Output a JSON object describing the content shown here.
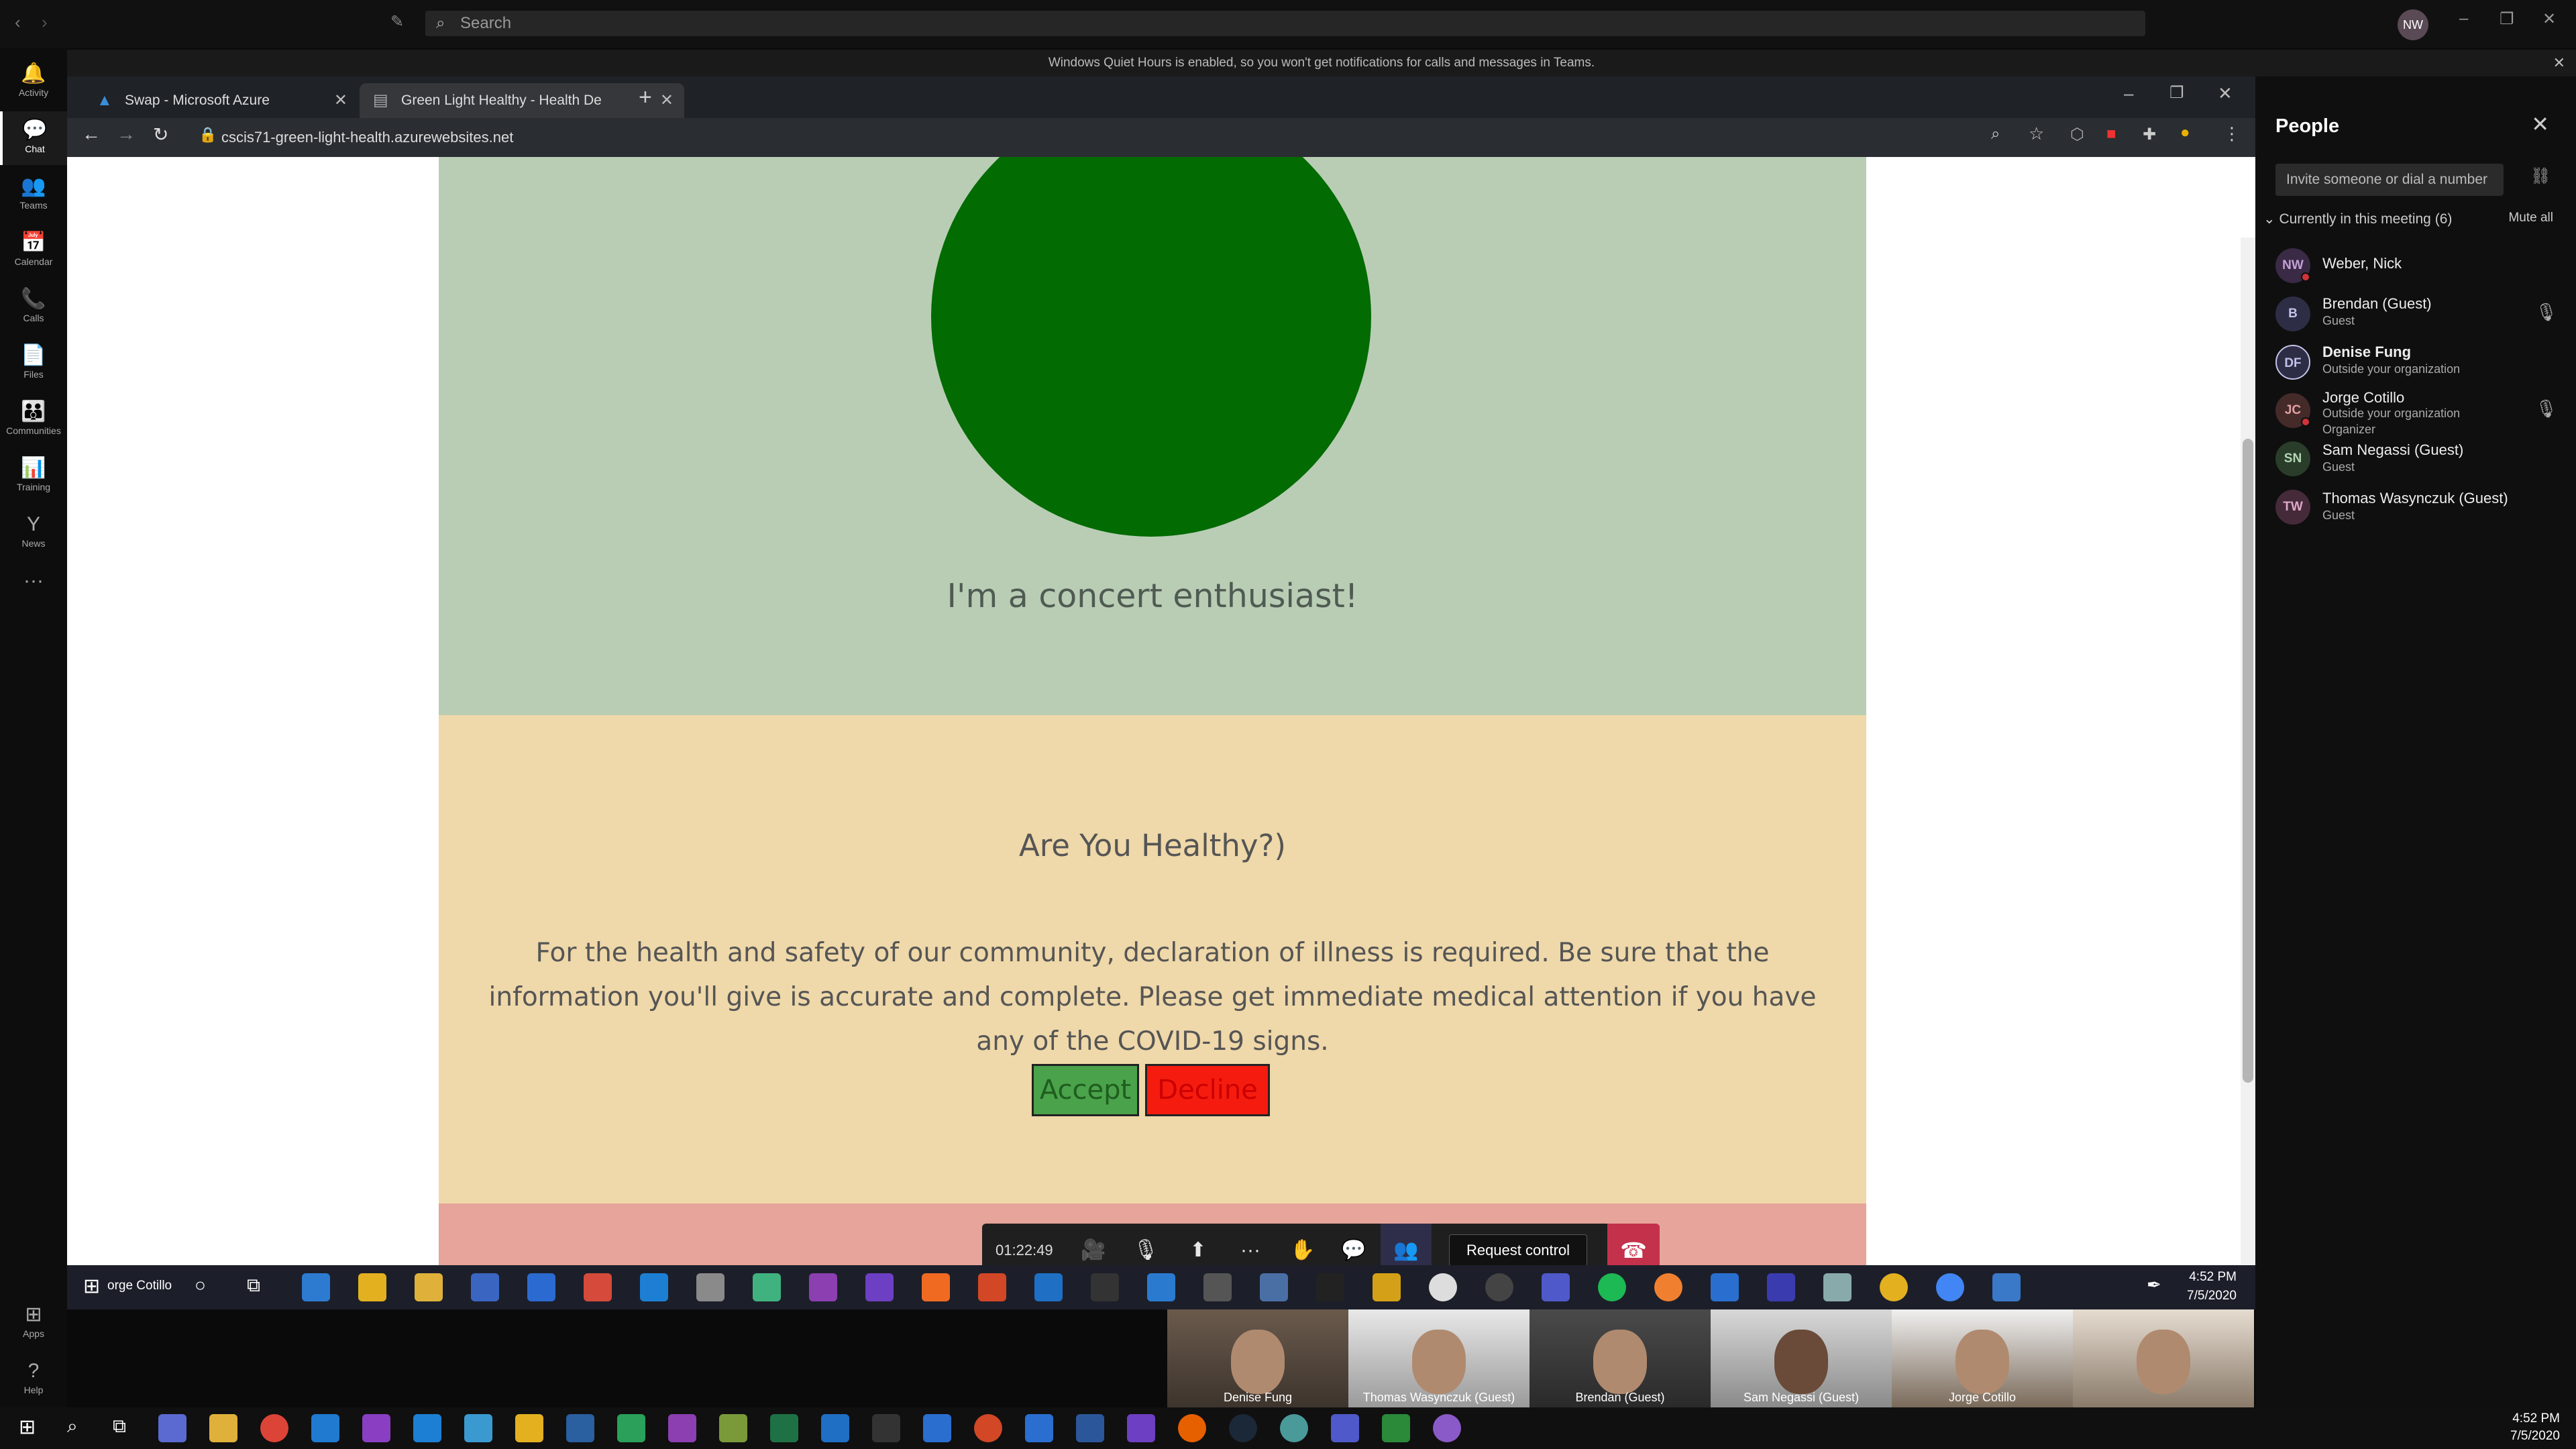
{
  "teams": {
    "search_placeholder": "Search",
    "avatar_initials": "NW",
    "notice": "Windows Quiet Hours is enabled, so you won't get notifications for calls and messages in Teams."
  },
  "rail": {
    "items": [
      {
        "label": "Activity",
        "icon": "bell-icon",
        "glyph": "🔔"
      },
      {
        "label": "Chat",
        "icon": "chat-icon",
        "glyph": "💬"
      },
      {
        "label": "Teams",
        "icon": "teams-icon",
        "glyph": "👥"
      },
      {
        "label": "Calendar",
        "icon": "calendar-icon",
        "glyph": "📅"
      },
      {
        "label": "Calls",
        "icon": "phone-icon",
        "glyph": "📞"
      },
      {
        "label": "Files",
        "icon": "file-icon",
        "glyph": "📄"
      },
      {
        "label": "Communities",
        "icon": "communities-icon",
        "glyph": "👪"
      },
      {
        "label": "Training",
        "icon": "training-icon",
        "glyph": "📊"
      },
      {
        "label": "News",
        "icon": "news-icon",
        "glyph": "Y"
      }
    ],
    "apps_label": "Apps",
    "help_label": "Help"
  },
  "browser": {
    "tabs": [
      {
        "title": "Swap - Microsoft Azure"
      },
      {
        "title": "Green Light Healthy - Health De"
      }
    ],
    "url": "cscis71-green-light-health.azurewebsites.net"
  },
  "page": {
    "concert_text": "I'm a concert enthusiast!",
    "health_title": "Are You Healthy?)",
    "health_text": "For the health and safety of our community, declaration of illness is required. Be sure that the information you'll give is accurate and complete. Please get immediate medical attention if you have any of the COVID-19 signs.",
    "accept_label": "Accept",
    "decline_label": "Decline",
    "colors": {
      "circle": "#026b02",
      "green_bg": "#b9cdb5",
      "beige_bg": "#efd8a9",
      "pink_bg": "#e6a49a"
    }
  },
  "call": {
    "timer": "01:22:49",
    "request_control": "Request control"
  },
  "people": {
    "title": "People",
    "invite_placeholder": "Invite someone or dial a number",
    "in_meeting": "Currently in this meeting (6)",
    "mute_all": "Mute all",
    "members": [
      {
        "initials": "NW",
        "name": "Weber, Nick",
        "sub1": "",
        "sub2": "",
        "color": "#c3a0d6",
        "bg": "#3a2a45"
      },
      {
        "initials": "B",
        "name": "Brendan (Guest)",
        "sub1": "Guest",
        "sub2": "",
        "color": "#c3c3ea",
        "bg": "#2d2d45"
      },
      {
        "initials": "DF",
        "name": "Denise Fung",
        "sub1": "Outside your organization",
        "sub2": "",
        "color": "#c3c3ea",
        "bg": "#2d2d45"
      },
      {
        "initials": "JC",
        "name": "Jorge Cotillo",
        "sub1": "Outside your organization",
        "sub2": "Organizer",
        "color": "#e0a0a0",
        "bg": "#452a2a"
      },
      {
        "initials": "SN",
        "name": "Sam Negassi (Guest)",
        "sub1": "Guest",
        "sub2": "",
        "color": "#b5d6b5",
        "bg": "#2a3d2a"
      },
      {
        "initials": "TW",
        "name": "Thomas Wasynczuk (Guest)",
        "sub1": "Guest",
        "sub2": "",
        "color": "#e0a8c8",
        "bg": "#452a3a"
      }
    ]
  },
  "taskbar": {
    "inner_label": "orge Cotillo",
    "inner_time": "4:52 PM",
    "inner_date": "7/5/2020",
    "outer_time": "4:52 PM",
    "outer_date": "7/5/2020"
  },
  "videos": [
    {
      "label": "Denise Fung"
    },
    {
      "label": "Thomas Wasynczuk (Guest)"
    },
    {
      "label": "Brendan (Guest)"
    },
    {
      "label": "Sam Negassi (Guest)"
    },
    {
      "label": "Jorge Cotillo"
    },
    {
      "label": ""
    }
  ]
}
